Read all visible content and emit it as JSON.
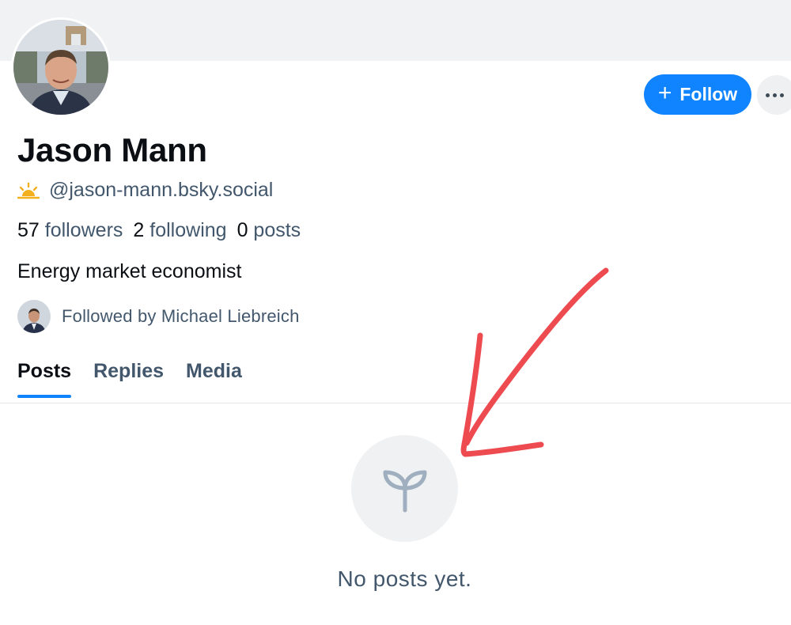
{
  "profile": {
    "display_name": "Jason Mann",
    "handle": "@jason-mann.bsky.social",
    "handle_icon": "sunrise-icon",
    "bio": "Energy market economist",
    "followed_by": "Followed by Michael Liebreich"
  },
  "stats": {
    "followers_count": "57",
    "followers_label": "followers",
    "following_count": "2",
    "following_label": "following",
    "posts_count": "0",
    "posts_label": "posts"
  },
  "actions": {
    "follow_label": "Follow",
    "follow_icon": "plus-icon",
    "more_icon": "ellipsis-icon"
  },
  "tabs": [
    {
      "label": "Posts",
      "active": true
    },
    {
      "label": "Replies",
      "active": false
    },
    {
      "label": "Media",
      "active": false
    }
  ],
  "empty_state": {
    "icon": "seedling-icon",
    "message": "No posts yet."
  },
  "colors": {
    "accent": "#1083fe",
    "muted_text": "#42576c",
    "banner": "#f1f2f4",
    "annotation_arrow": "#ee4b51"
  }
}
